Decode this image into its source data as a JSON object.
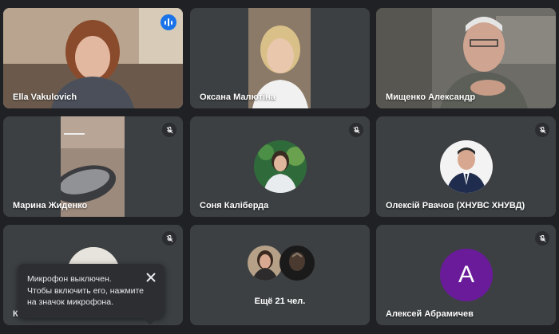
{
  "participants": [
    {
      "name": "Ella Vakulovich",
      "active": true
    },
    {
      "name": "Оксана Малютіна"
    },
    {
      "name": "Мищенко Александр"
    },
    {
      "name": "Марина Жиденко"
    },
    {
      "name": "Соня Калiберда"
    },
    {
      "name": "Олексій Рвачов (ХНУВС ХНУВД)"
    },
    {
      "name": "К"
    },
    {
      "more_label": "Ещё 21 чел."
    },
    {
      "name": "Алексей Абрамичев",
      "avatar_letter": "A"
    }
  ],
  "toast": {
    "line1": "Микрофон выключен.",
    "line2": "Чтобы включить его, нажмите",
    "line3": "на значок микрофона."
  },
  "colors": {
    "background": "#202124",
    "tile": "#3c4043",
    "active_border": "#8ab4f8",
    "speaking": "#1a73e8",
    "letter_avatar": "#6a1b9a"
  }
}
